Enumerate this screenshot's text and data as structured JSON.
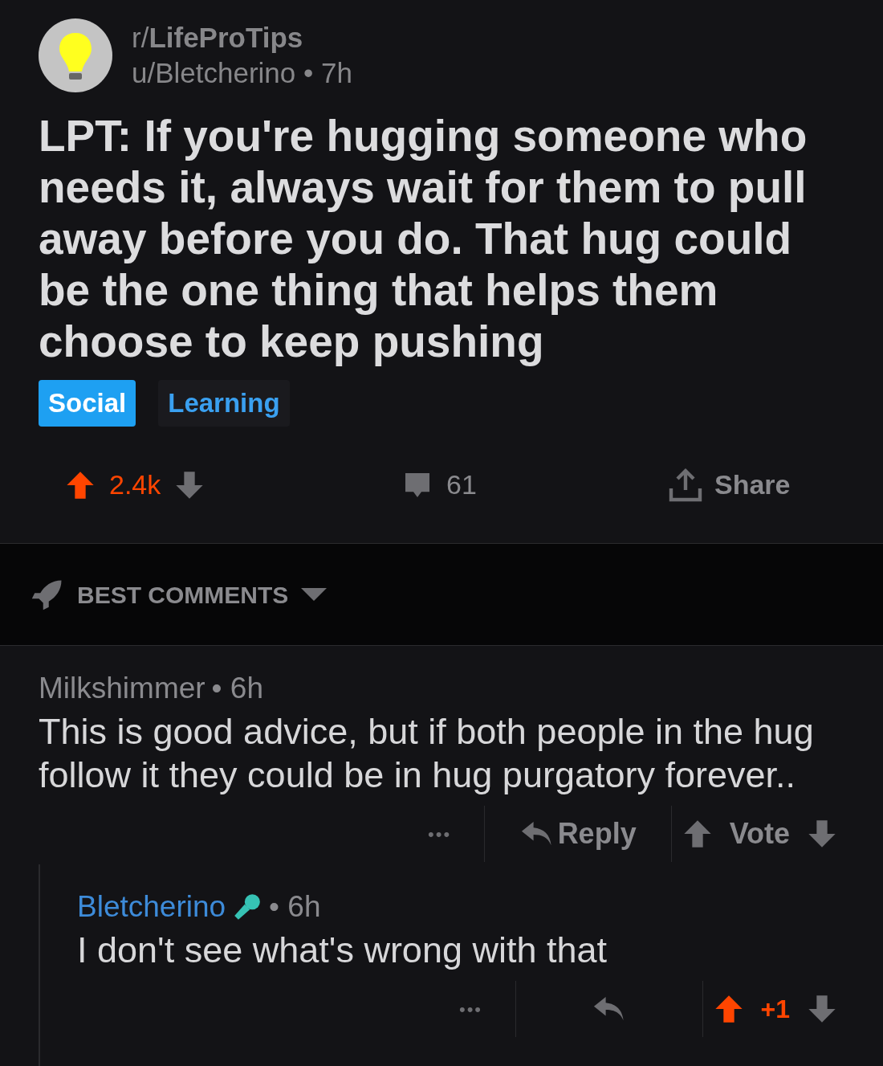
{
  "post": {
    "subreddit": "r/**LifeProTips**",
    "byline": "u/Bletcherino • 7h",
    "title": "LPT: If you're hugging someone who needs it, always wait for them to pull away before you do. That hug could be the one thing that helps them choose to keep pushing",
    "flairs": [
      {
        "label": "Social",
        "filled": true
      },
      {
        "label": "Learning",
        "filled": false
      }
    ],
    "score": "2.4k",
    "upvoted": true,
    "comments_count": "61",
    "share_label": "Share"
  },
  "sort": {
    "label": "BEST COMMENTS"
  },
  "comments": [
    {
      "author": "Milkshimmer",
      "is_op": false,
      "age": "• 6h",
      "body": "This is good advice, but if both people in the hug follow it they could be in hug purgatory forever..",
      "more": "•••",
      "reply_label": "Reply",
      "vote_label": "Vote",
      "upvoted": false,
      "children": [
        {
          "author": "Bletcherino",
          "is_op": true,
          "age": "• 6h",
          "body": "I don't see what's wrong with that",
          "more": "•••",
          "score": "+1",
          "upvoted": true
        }
      ]
    }
  ]
}
